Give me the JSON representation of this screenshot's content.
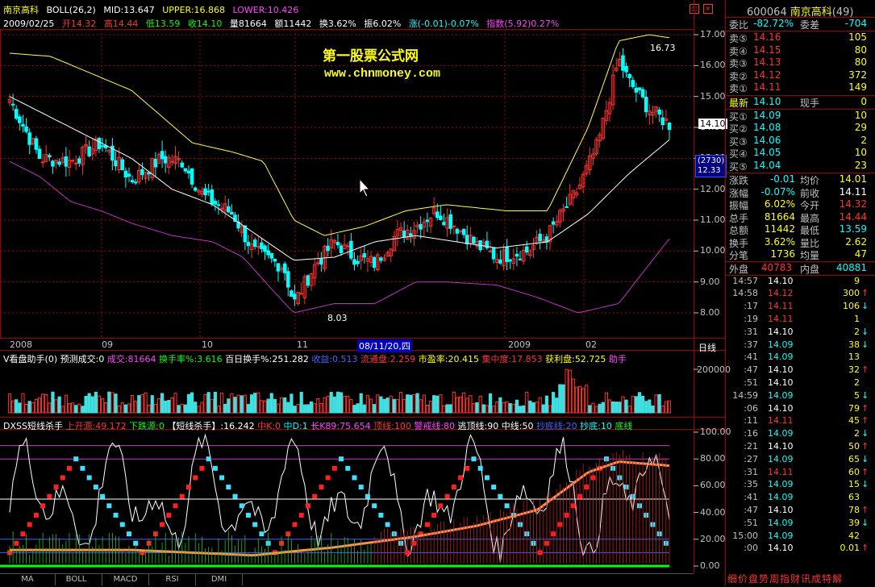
{
  "header": {
    "stock_name": "南京高科",
    "indicator": "BOLL(26,2)",
    "mid": "MID:13.647",
    "upper": "UPPER:16.868",
    "lower": "LOWER:10.426",
    "date": "2009/02/25",
    "open": "开14.32",
    "high": "高14.44",
    "low": "低13.59",
    "close": "收14.10",
    "vol": "量81664",
    "amount": "额11442",
    "turnover": "换3.62%",
    "amplitude": "振6.02%",
    "change": "涨(-0.01)-0.07%",
    "index": "指数(5.92)0.27%"
  },
  "watermark": {
    "title": "第一股票公式网",
    "url": "www.chnmoney.com"
  },
  "main_chart": {
    "y_ticks": [
      "17.00",
      "16.00",
      "15.00",
      "14.00",
      "13.00",
      "12.00",
      "11.00",
      "10.00",
      "9.00",
      "8.00"
    ],
    "high_label": "16.73",
    "low_label": "8.03",
    "price_tag": "14.10",
    "vol_tag": "(2730)",
    "vol_tag_val": "12.33",
    "x_labels": [
      "2008",
      "09",
      "10",
      "11",
      "08/11/20,四",
      "2009",
      "02"
    ],
    "right_label": "日线"
  },
  "volume_panel": {
    "title": "V看盘助手(0)",
    "items": [
      "预测成交:0",
      "成交:81664",
      "换手率%:3.616",
      "百日换手%:251.282",
      "收益:0.513",
      "流通盘:2.259",
      "市盈率:20.415",
      "集中度:17.853",
      "获利盘:52.725",
      "助手"
    ],
    "y_tick": "200000"
  },
  "kd_panel": {
    "title": "DXSS短线杀手",
    "items": [
      "上开源:49.172",
      "下跌源:0",
      "【短线杀手】:16.242",
      "中K:0",
      "中D:1",
      "长K89:75.654",
      "顶线:100",
      "警戒线:80",
      "逃顶线:90",
      "中线:50",
      "抄底线:20",
      "抄底:10",
      "底线"
    ],
    "y_ticks": [
      "100.00",
      "80.00",
      "60.00",
      "40.00",
      "20.00",
      "0.00"
    ]
  },
  "bottom_tabs": [
    "MA",
    "BOLL",
    "MACD",
    "RSI",
    "DMI"
  ],
  "quote": {
    "code": "600064",
    "name": "南京高科",
    "count": "(49)",
    "weibi_label": "委比",
    "weibi": "-82.72%",
    "weicha_label": "委差",
    "weicha": "-704",
    "sells": [
      {
        "label": "卖⑤",
        "price": "14.16",
        "vol": "105"
      },
      {
        "label": "卖④",
        "price": "14.15",
        "vol": "80"
      },
      {
        "label": "卖③",
        "price": "14.13",
        "vol": "80"
      },
      {
        "label": "卖②",
        "price": "14.12",
        "vol": "372"
      },
      {
        "label": "卖①",
        "price": "14.11",
        "vol": "149"
      }
    ],
    "last_label": "最新",
    "last": "14.10",
    "xianshou_label": "现手",
    "xianshou": "0",
    "buys": [
      {
        "label": "买①",
        "price": "14.09",
        "vol": "10"
      },
      {
        "label": "买②",
        "price": "14.08",
        "vol": "29"
      },
      {
        "label": "买③",
        "price": "14.06",
        "vol": "2"
      },
      {
        "label": "买④",
        "price": "14.05",
        "vol": "10"
      },
      {
        "label": "买⑤",
        "price": "14.04",
        "vol": "23"
      }
    ],
    "stats": [
      {
        "l1": "涨跌",
        "v1": "-0.01",
        "l2": "均价",
        "v2": "14.01"
      },
      {
        "l1": "涨幅",
        "v1": "-0.07%",
        "l2": "前收",
        "v2": "14.11"
      },
      {
        "l1": "振幅",
        "v1": "6.02%",
        "l2": "今开",
        "v2": "14.32"
      },
      {
        "l1": "总手",
        "v1": "81664",
        "l2": "最高",
        "v2": "14.44"
      },
      {
        "l1": "总额",
        "v1": "11442",
        "l2": "最低",
        "v2": "13.59"
      },
      {
        "l1": "换手",
        "v1": "3.62%",
        "l2": "量比",
        "v2": "2.62"
      },
      {
        "l1": "分笔",
        "v1": "1736",
        "l2": "均量",
        "v2": "47"
      }
    ],
    "waipan_label": "外盘",
    "waipan": "40783",
    "neipan_label": "内盘",
    "neipan": "40881"
  },
  "ticks": [
    {
      "t": "14:57",
      "p": "14.10",
      "v": "9",
      "dir": ""
    },
    {
      "t": "14:58",
      "p": "14.12",
      "v": "300",
      "dir": "↑"
    },
    {
      "t": ":17",
      "p": "14.11",
      "v": "106",
      "dir": "↓"
    },
    {
      "t": ":19",
      "p": "14.11",
      "v": "1",
      "dir": ""
    },
    {
      "t": ":31",
      "p": "14.10",
      "v": "2",
      "dir": "↓"
    },
    {
      "t": ":37",
      "p": "14.09",
      "v": "38",
      "dir": "↓"
    },
    {
      "t": ":41",
      "p": "14.09",
      "v": "13",
      "dir": ""
    },
    {
      "t": ":47",
      "p": "14.10",
      "v": "32",
      "dir": "↑"
    },
    {
      "t": ":51",
      "p": "14.10",
      "v": "2",
      "dir": ""
    },
    {
      "t": "14:59",
      "p": "14.09",
      "v": "5",
      "dir": "↓"
    },
    {
      "t": ":06",
      "p": "14.10",
      "v": "79",
      "dir": "↑"
    },
    {
      "t": ":11",
      "p": "14.11",
      "v": "45",
      "dir": "↑"
    },
    {
      "t": ":16",
      "p": "14.09",
      "v": "2",
      "dir": "↓"
    },
    {
      "t": ":21",
      "p": "14.10",
      "v": "50",
      "dir": "↑"
    },
    {
      "t": ":27",
      "p": "14.09",
      "v": "65",
      "dir": "↓"
    },
    {
      "t": ":31",
      "p": "14.11",
      "v": "60",
      "dir": "↑"
    },
    {
      "t": ":35",
      "p": "14.09",
      "v": "15",
      "dir": "↓"
    },
    {
      "t": ":41",
      "p": "14.09",
      "v": "63",
      "dir": ""
    },
    {
      "t": ":47",
      "p": "14.10",
      "v": "78",
      "dir": "↑"
    },
    {
      "t": ":51",
      "p": "14.09",
      "v": "39",
      "dir": "↓"
    },
    {
      "t": "15:00",
      "p": "14.09",
      "v": "42",
      "dir": ""
    },
    {
      "t": ":00",
      "p": "14.10",
      "v": "0.01",
      "dir": "↑"
    }
  ],
  "footer_tabs": [
    "细",
    "价",
    "盘",
    "势",
    "周",
    "指",
    "财",
    "讯",
    "成",
    "特",
    "解"
  ],
  "colors": {
    "up": "#ff3030",
    "down": "#00ffff",
    "grid": "#a00000",
    "upper": "#ffff40",
    "mid": "#ffffff",
    "lower": "#c030c0"
  }
}
